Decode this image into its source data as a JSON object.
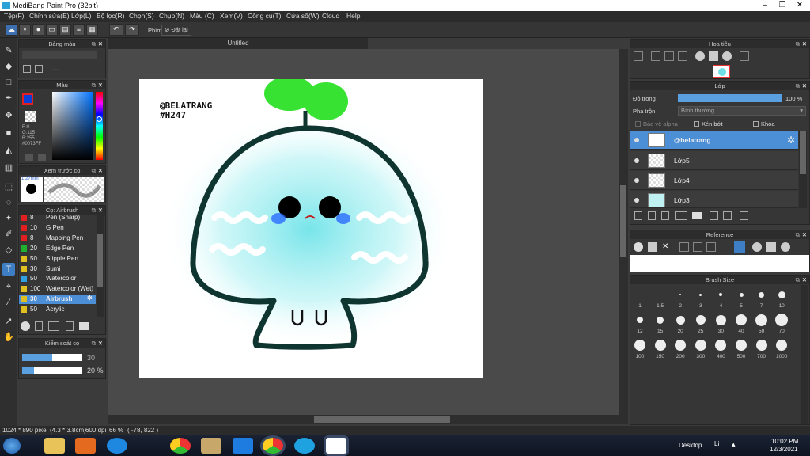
{
  "window": {
    "title": "MediBang Paint Pro (32bit)"
  },
  "menu": [
    "Tệp(F)",
    "Chỉnh sửa(E)",
    "Lớp(L)",
    "Bộ lọc(R)",
    "Chọn(S)",
    "Chụp(N)",
    "Màu (C)",
    "Xem(V)",
    "Công cụ(T)",
    "Cửa sổ(W)",
    "Cloud",
    "Help"
  ],
  "toolbar": {
    "keys_label": "Phím",
    "reset_label": "Đặt lại"
  },
  "canvas": {
    "tab_title": "Untitled",
    "signature_line1": "@BELATRANG",
    "signature_line2": "#H247"
  },
  "palette_panel": {
    "title": "Bảng màu",
    "dash": "---"
  },
  "color_panel": {
    "title": "Màu",
    "r": "R:0",
    "g": "G:115",
    "b": "B:255",
    "hex": "#0073FF",
    "fg_color": "#0a3fd8",
    "accent": "#e32020"
  },
  "preview_panel": {
    "title": "Xem trước cọ",
    "size": "1.27mm"
  },
  "brush_panel": {
    "title": "Cọ: Airbrush",
    "items": [
      {
        "size": "8",
        "name": "Pen (Sharp)",
        "color": "#e02020"
      },
      {
        "size": "10",
        "name": "G Pen",
        "color": "#e02020"
      },
      {
        "size": "8",
        "name": "Mapping Pen",
        "color": "#e02020"
      },
      {
        "size": "20",
        "name": "Edge Pen",
        "color": "#20b030"
      },
      {
        "size": "50",
        "name": "Stipple Pen",
        "color": "#e0c020"
      },
      {
        "size": "30",
        "name": "Sumi",
        "color": "#e0c020"
      },
      {
        "size": "50",
        "name": "Watercolor",
        "color": "#30a0e0"
      },
      {
        "size": "100",
        "name": "Watercolor (Wet)",
        "color": "#e0c020"
      },
      {
        "size": "30",
        "name": "Airbrush",
        "color": "#e0c020"
      },
      {
        "size": "50",
        "name": "Acrylic",
        "color": "#e0c020"
      }
    ]
  },
  "brush_control": {
    "title": "Kiểm soát cọ",
    "size_value": "30",
    "opacity_value": "20 %",
    "size_fill": 0.5,
    "opacity_fill": 0.2
  },
  "navigator": {
    "title": "Hoa tiêu"
  },
  "layer_panel": {
    "title": "Lớp",
    "opacity_label": "Độ trong",
    "opacity_value": "100 %",
    "blend_label": "Pha trộn",
    "blend_value": "Bình thường",
    "protect_alpha": "Bảo vệ alpha",
    "clipping": "Xén bớt",
    "lock": "Khóa",
    "layers": [
      "@belatrang",
      "Lớp5",
      "Lớp4",
      "Lớp3"
    ]
  },
  "reference": {
    "title": "Reference"
  },
  "brush_size": {
    "title": "Brush Size",
    "row1": [
      "1",
      "1.5",
      "2",
      "3",
      "4",
      "5",
      "7",
      "10"
    ],
    "row2": [
      "12",
      "15",
      "20",
      "25",
      "30",
      "40",
      "50",
      "70"
    ],
    "row3": [
      "100",
      "150",
      "200",
      "300",
      "400",
      "500",
      "700",
      "1000"
    ]
  },
  "status": {
    "dims": "1024 * 890 pixel",
    "cm": "(4.3 * 3.8cm)",
    "dpi": "600 dpi",
    "zoom": "66 %",
    "coords": "( -78, 822 )"
  },
  "taskbar": {
    "desktop": "Desktop",
    "lang": "Li",
    "time": "10:02 PM",
    "date": "12/3/2021"
  }
}
